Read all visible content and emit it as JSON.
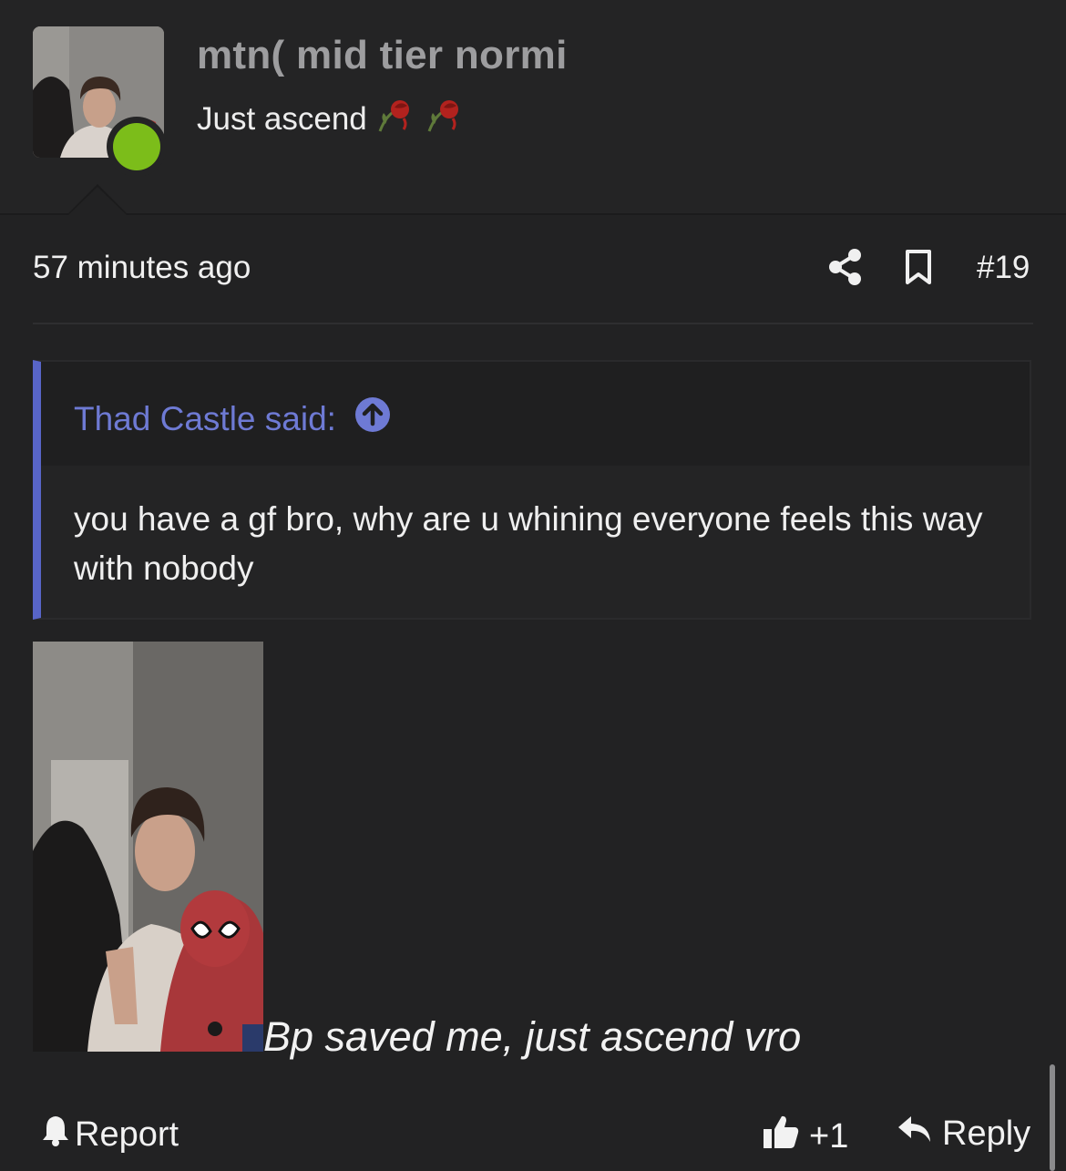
{
  "post": {
    "username": "mtn( mid tier normi",
    "user_title": "Just ascend",
    "user_title_icons": [
      "wilted-rose-icon",
      "wilted-rose-icon"
    ],
    "online": true,
    "timestamp": "57 minutes ago",
    "post_number": "#19"
  },
  "quote": {
    "author": "Thad Castle said:",
    "body": "you have a gf bro, why are u whining everyone feels this way with nobody"
  },
  "content": {
    "caption": "Bp saved me, just ascend vro"
  },
  "footer": {
    "report_label": "Report",
    "like_count": "+1",
    "reply_label": "Reply"
  },
  "colors": {
    "background": "#222223",
    "accent_quote": "#5865c8",
    "quote_author": "#6e7ad4",
    "online": "#7cbd1a",
    "username": "#9d9d9f"
  }
}
